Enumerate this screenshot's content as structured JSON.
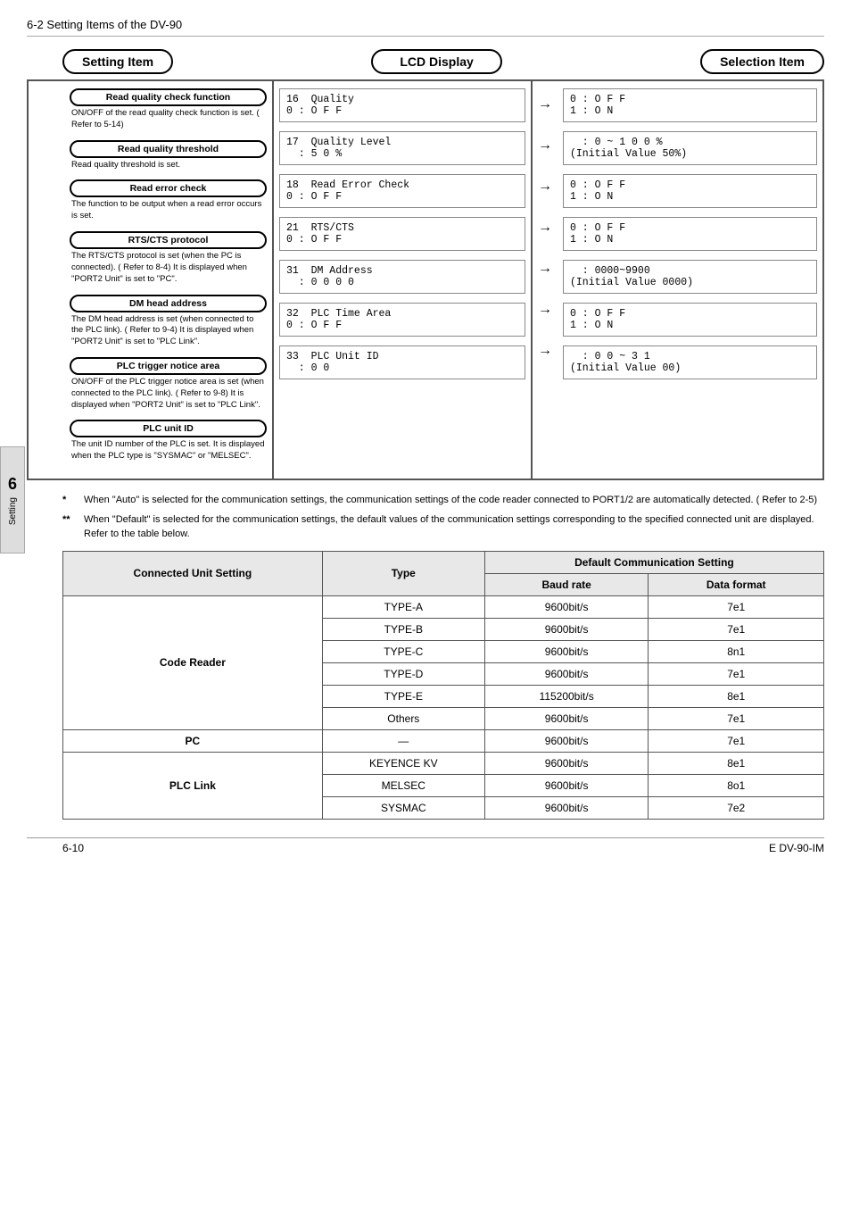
{
  "header": {
    "title": "6-2  Setting Items of the DV-90"
  },
  "columns": {
    "left": "Setting Item",
    "center": "LCD Display",
    "right": "Selection Item"
  },
  "settingItems": [
    {
      "label": "Read quality check function",
      "desc": "ON/OFF of the read quality check function is set. (  Refer to 5-14)"
    },
    {
      "label": "Read quality threshold",
      "desc": "Read quality threshold is set."
    },
    {
      "label": "Read error check",
      "desc": "The function to be output when a read error occurs is set."
    },
    {
      "label": "RTS/CTS protocol",
      "desc": "The RTS/CTS protocol is set (when the PC is connected). (  Refer to 8-4)\nIt is displayed when \"PORT2 Unit\" is set to \"PC\"."
    },
    {
      "label": "DM head address",
      "desc": "The DM head address is set (when connected to the PLC link).\n(  Refer to 9-4)\nIt is displayed when \"PORT2 Unit\" is set to \"PLC Link\"."
    },
    {
      "label": "PLC trigger notice area",
      "desc": "ON/OFF of the PLC trigger notice area is set (when connected to the PLC link). (  Refer to 9-8)\nIt is displayed when \"PORT2 Unit\" is set to \"PLC Link\"."
    },
    {
      "label": "PLC unit ID",
      "desc": "The unit ID number of the PLC is set.\nIt is displayed when the PLC type is \"SYSMAC\" or \"MELSEC\"."
    }
  ],
  "lcdEntries": [
    "16  Quality\n0 : O F F",
    "17  Quality Level\n  : 5 0 %",
    "18  Read Error Check\n0 : O F F",
    "21  RTS/CTS\n0 : O F F",
    "31  DM Address\n  : 0 0 0 0",
    "32  PLC Time Area\n0 : O F F",
    "33  PLC Unit ID\n  : 0 0"
  ],
  "selectionEntries": [
    "0 : O F F\n1 : O N",
    "  : 0 ~ 1 0 0 %\n(Initial Value 50%)",
    "0 : O F F\n1 : O N",
    "0 : O F F\n1 : O N",
    "  : 0000~9900\n(Initial Value 0000)",
    "0 : O F F\n1 : O N",
    "  : 0 0 ~ 3 1\n(Initial Value 00)"
  ],
  "notes": [
    {
      "star": "*",
      "text": "When \"Auto\" is selected for the communication settings, the communication settings of the code reader connected to PORT1/2 are automatically detected. (    Refer to 2-5)"
    },
    {
      "star": "**",
      "text": "When \"Default\" is selected for the communication settings, the default values of the communication settings corresponding to the specified connected unit are displayed. Refer to the table below."
    }
  ],
  "table": {
    "col1": "Connected Unit Setting",
    "col2": "Type",
    "col3header": "Default Communication Setting",
    "col3a": "Baud rate",
    "col3b": "Data format",
    "rows": [
      {
        "unit": "Code Reader",
        "type": "TYPE-A",
        "baud": "9600bit/s",
        "format": "7e1"
      },
      {
        "unit": "",
        "type": "TYPE-B",
        "baud": "9600bit/s",
        "format": "7e1"
      },
      {
        "unit": "",
        "type": "TYPE-C",
        "baud": "9600bit/s",
        "format": "8n1"
      },
      {
        "unit": "",
        "type": "TYPE-D",
        "baud": "9600bit/s",
        "format": "7e1"
      },
      {
        "unit": "",
        "type": "TYPE-E",
        "baud": "115200bit/s",
        "format": "8e1"
      },
      {
        "unit": "",
        "type": "Others",
        "baud": "9600bit/s",
        "format": "7e1"
      },
      {
        "unit": "PC",
        "type": "—",
        "baud": "9600bit/s",
        "format": "7e1"
      },
      {
        "unit": "PLC Link",
        "type": "KEYENCE KV",
        "baud": "9600bit/s",
        "format": "8e1"
      },
      {
        "unit": "",
        "type": "MELSEC",
        "baud": "9600bit/s",
        "format": "8o1"
      },
      {
        "unit": "",
        "type": "SYSMAC",
        "baud": "9600bit/s",
        "format": "7e2"
      }
    ]
  },
  "sidebar": {
    "number": "6",
    "label": "Setting"
  },
  "footer": {
    "left": "6-10",
    "right": "E DV-90-IM"
  }
}
